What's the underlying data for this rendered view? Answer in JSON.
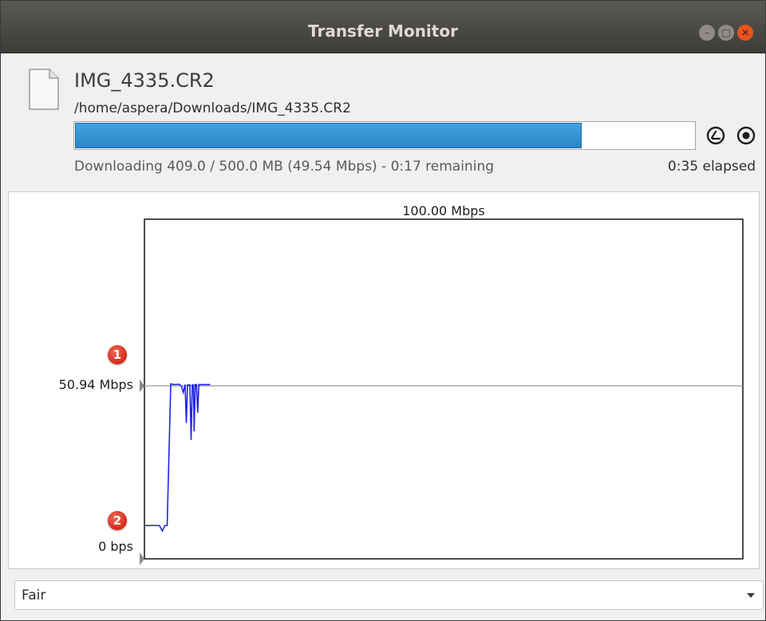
{
  "window": {
    "title": "Transfer Monitor",
    "buttons": {
      "minimize": "minimize-icon",
      "maximize": "maximize-icon",
      "close": "close-icon"
    }
  },
  "file": {
    "name": "IMG_4335.CR2",
    "path": "/home/aspera/Downloads/IMG_4335.CR2",
    "icon": "document-icon"
  },
  "transfer": {
    "progress_fraction": 0.818,
    "status": "Downloading 409.0 / 500.0 MB (49.54 Mbps) - 0:17 remaining",
    "elapsed": "0:35 elapsed",
    "controls": {
      "rate": "rate-control-icon",
      "stop": "stop-icon"
    },
    "accent_color": "#2a86c8"
  },
  "graph": {
    "max_label": "100.00 Mbps",
    "target_label": "50.94 Mbps",
    "min_label": "0 bps",
    "badges": [
      "1",
      "2"
    ],
    "line_color": "#2222ee"
  },
  "chart_data": {
    "type": "line",
    "title": "",
    "xlabel": "",
    "ylabel": "",
    "ylim": [
      0,
      100
    ],
    "xlim": [
      0,
      100
    ],
    "reference_line": 50.94,
    "series": [
      {
        "values": [
          [
            0,
            9.8
          ],
          [
            1.5,
            9.8
          ],
          [
            2.5,
            9.8
          ],
          [
            3.0,
            8.2
          ],
          [
            3.4,
            9.8
          ],
          [
            3.8,
            9.8
          ],
          [
            4.4,
            51.5
          ],
          [
            5.0,
            51.3
          ],
          [
            5.8,
            51.4
          ],
          [
            6.2,
            50.8
          ],
          [
            6.5,
            49.0
          ],
          [
            6.8,
            51.3
          ],
          [
            7.0,
            40.0
          ],
          [
            7.2,
            51.2
          ],
          [
            7.6,
            51.2
          ],
          [
            7.8,
            35.0
          ],
          [
            8.0,
            51.2
          ],
          [
            8.2,
            51.2
          ],
          [
            8.3,
            37.5
          ],
          [
            8.5,
            51.3
          ],
          [
            8.7,
            51.3
          ],
          [
            8.9,
            43.0
          ],
          [
            9.1,
            51.3
          ],
          [
            10.5,
            51.3
          ],
          [
            11.0,
            51.3
          ]
        ]
      }
    ]
  },
  "policy": {
    "selected": "Fair",
    "arrow": "dropdown-arrow-icon"
  }
}
